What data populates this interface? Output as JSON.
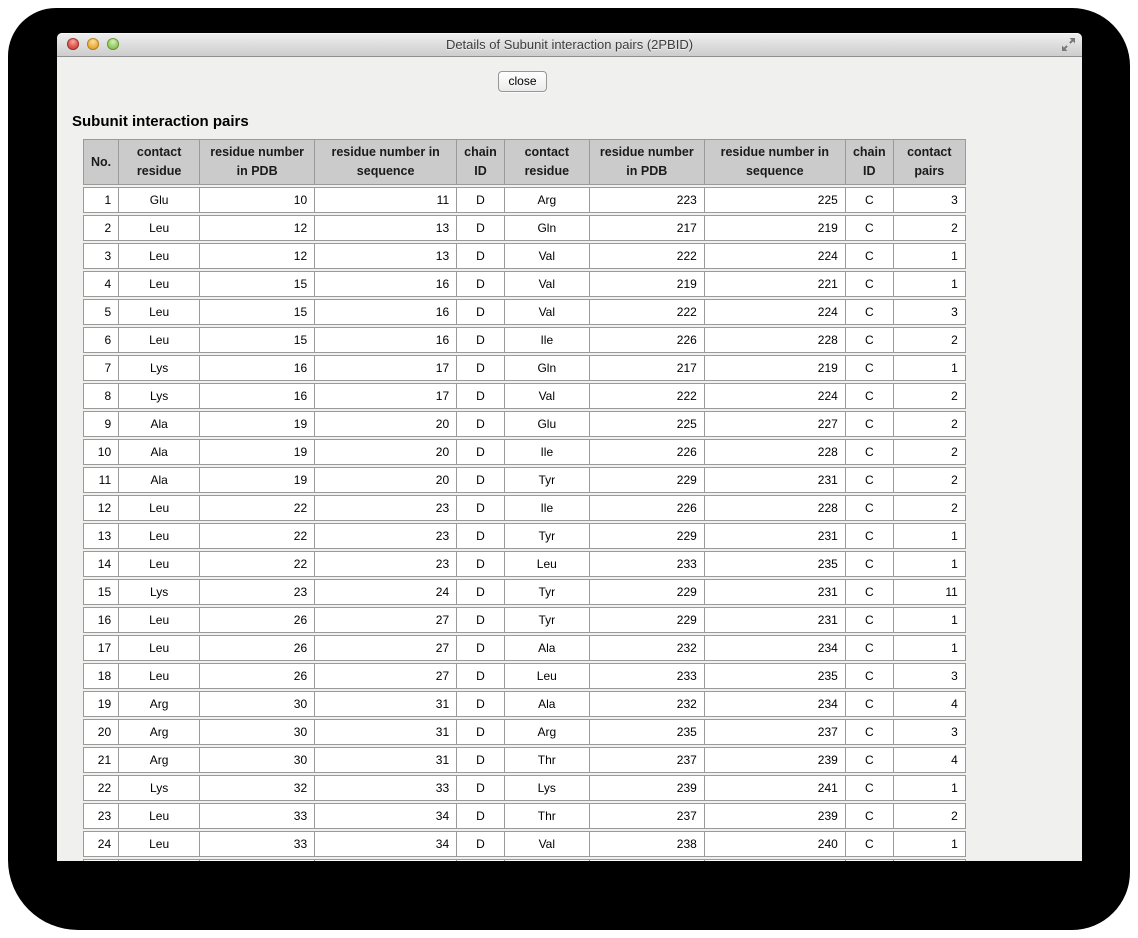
{
  "window": {
    "title": "Details of Subunit interaction pairs (2PBID)",
    "traffic_lights": {
      "close": "red",
      "minimize": "yellow",
      "zoom": "green"
    }
  },
  "toolbar": {
    "close_label": "close"
  },
  "section": {
    "title": "Subunit interaction pairs"
  },
  "table": {
    "headers": [
      "No.",
      "contact\nresidue",
      "residue number\nin PDB",
      "residue number in\nsequence",
      "chain\nID",
      "contact\nresidue",
      "residue number\nin PDB",
      "residue number in\nsequence",
      "chain\nID",
      "contact\npairs"
    ],
    "rows": [
      [
        "1",
        "Glu",
        "10",
        "11",
        "D",
        "Arg",
        "223",
        "225",
        "C",
        "3"
      ],
      [
        "2",
        "Leu",
        "12",
        "13",
        "D",
        "Gln",
        "217",
        "219",
        "C",
        "2"
      ],
      [
        "3",
        "Leu",
        "12",
        "13",
        "D",
        "Val",
        "222",
        "224",
        "C",
        "1"
      ],
      [
        "4",
        "Leu",
        "15",
        "16",
        "D",
        "Val",
        "219",
        "221",
        "C",
        "1"
      ],
      [
        "5",
        "Leu",
        "15",
        "16",
        "D",
        "Val",
        "222",
        "224",
        "C",
        "3"
      ],
      [
        "6",
        "Leu",
        "15",
        "16",
        "D",
        "Ile",
        "226",
        "228",
        "C",
        "2"
      ],
      [
        "7",
        "Lys",
        "16",
        "17",
        "D",
        "Gln",
        "217",
        "219",
        "C",
        "1"
      ],
      [
        "8",
        "Lys",
        "16",
        "17",
        "D",
        "Val",
        "222",
        "224",
        "C",
        "2"
      ],
      [
        "9",
        "Ala",
        "19",
        "20",
        "D",
        "Glu",
        "225",
        "227",
        "C",
        "2"
      ],
      [
        "10",
        "Ala",
        "19",
        "20",
        "D",
        "Ile",
        "226",
        "228",
        "C",
        "2"
      ],
      [
        "11",
        "Ala",
        "19",
        "20",
        "D",
        "Tyr",
        "229",
        "231",
        "C",
        "2"
      ],
      [
        "12",
        "Leu",
        "22",
        "23",
        "D",
        "Ile",
        "226",
        "228",
        "C",
        "2"
      ],
      [
        "13",
        "Leu",
        "22",
        "23",
        "D",
        "Tyr",
        "229",
        "231",
        "C",
        "1"
      ],
      [
        "14",
        "Leu",
        "22",
        "23",
        "D",
        "Leu",
        "233",
        "235",
        "C",
        "1"
      ],
      [
        "15",
        "Lys",
        "23",
        "24",
        "D",
        "Tyr",
        "229",
        "231",
        "C",
        "11"
      ],
      [
        "16",
        "Leu",
        "26",
        "27",
        "D",
        "Tyr",
        "229",
        "231",
        "C",
        "1"
      ],
      [
        "17",
        "Leu",
        "26",
        "27",
        "D",
        "Ala",
        "232",
        "234",
        "C",
        "1"
      ],
      [
        "18",
        "Leu",
        "26",
        "27",
        "D",
        "Leu",
        "233",
        "235",
        "C",
        "3"
      ],
      [
        "19",
        "Arg",
        "30",
        "31",
        "D",
        "Ala",
        "232",
        "234",
        "C",
        "4"
      ],
      [
        "20",
        "Arg",
        "30",
        "31",
        "D",
        "Arg",
        "235",
        "237",
        "C",
        "3"
      ],
      [
        "21",
        "Arg",
        "30",
        "31",
        "D",
        "Thr",
        "237",
        "239",
        "C",
        "4"
      ],
      [
        "22",
        "Lys",
        "32",
        "33",
        "D",
        "Lys",
        "239",
        "241",
        "C",
        "1"
      ],
      [
        "23",
        "Leu",
        "33",
        "34",
        "D",
        "Thr",
        "237",
        "239",
        "C",
        "2"
      ],
      [
        "24",
        "Leu",
        "33",
        "34",
        "D",
        "Val",
        "238",
        "240",
        "C",
        "1"
      ]
    ]
  },
  "colors": {
    "titlebar_top": "#efefef",
    "titlebar_bottom": "#cdcdcd",
    "content_bg": "#f0f0ee",
    "header_cell_bg": "#cbcbcb",
    "cell_border": "#9a9a9a",
    "traffic_red": "#df564d",
    "traffic_yellow": "#ecb23f",
    "traffic_green": "#9bcd66",
    "shadow_bg": "#000000"
  }
}
